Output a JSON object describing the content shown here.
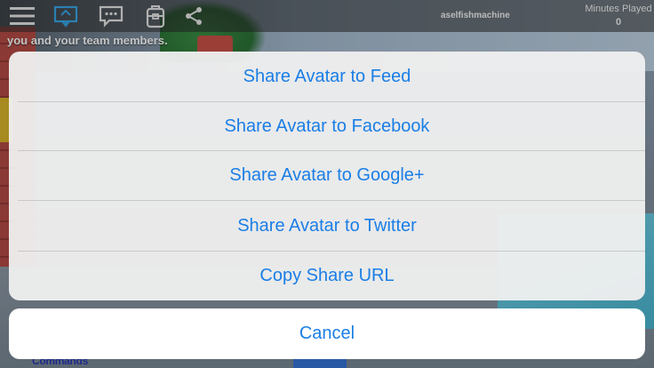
{
  "toolbar": {
    "icons": [
      "menu-icon",
      "ad-icon",
      "chat-icon",
      "backpack-icon",
      "share-icon"
    ],
    "active_color": "#2ba3e6"
  },
  "player": {
    "username": "aselfishmachine",
    "minutes_label": "Minutes Played",
    "minutes_value": "0"
  },
  "chat": {
    "line": "you and your team members."
  },
  "background": {
    "commands_label": "Commands"
  },
  "share_sheet": {
    "options": [
      "Share Avatar to Feed",
      "Share Avatar to Facebook",
      "Share Avatar to Google+",
      "Share Avatar to Twitter",
      "Copy Share URL"
    ],
    "cancel_label": "Cancel",
    "accent_color": "#1a7ee6"
  }
}
